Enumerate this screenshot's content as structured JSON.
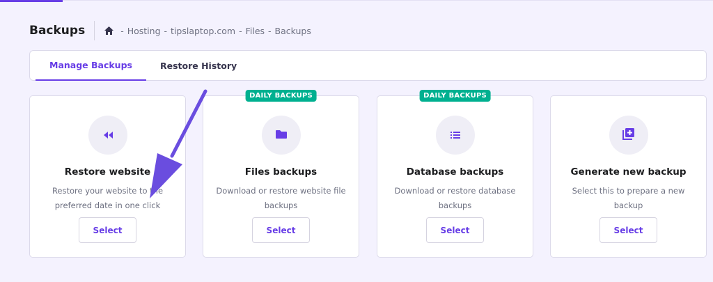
{
  "header": {
    "title": "Backups",
    "breadcrumb": [
      "Hosting",
      "tipslaptop.com",
      "Files",
      "Backups"
    ]
  },
  "tabs": [
    {
      "label": "Manage Backups",
      "active": true
    },
    {
      "label": "Restore History",
      "active": false
    }
  ],
  "cards": [
    {
      "icon": "rewind-icon",
      "title": "Restore website",
      "description": "Restore your website to the preferred date in one click",
      "button": "Select",
      "badge": ""
    },
    {
      "icon": "folder-icon",
      "title": "Files backups",
      "description": "Download or restore website file backups",
      "button": "Select",
      "badge": "DAILY BACKUPS"
    },
    {
      "icon": "list-icon",
      "title": "Database backups",
      "description": "Download or restore database backups",
      "button": "Select",
      "badge": "DAILY BACKUPS"
    },
    {
      "icon": "add-box-icon",
      "title": "Generate new backup",
      "description": "Select this to prepare a new backup",
      "button": "Select",
      "badge": ""
    }
  ],
  "colors": {
    "accent": "#673de6",
    "badge": "#00b090",
    "background": "#f4f2fe",
    "annotation_arrow": "#6a4ddf"
  }
}
